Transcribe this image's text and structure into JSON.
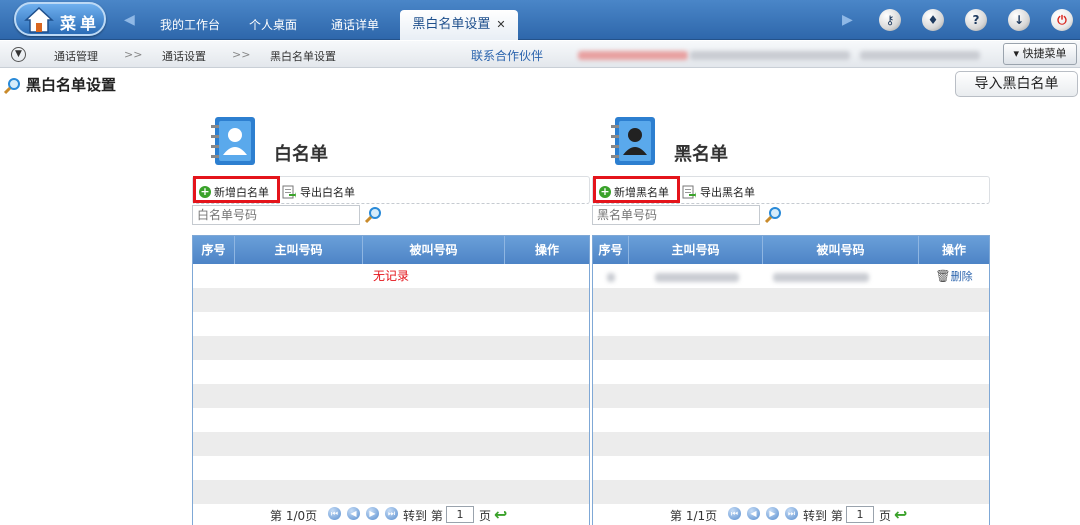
{
  "topbar": {
    "menu_label": "菜单",
    "tabs": [
      {
        "label": "我的工作台"
      },
      {
        "label": "个人桌面"
      },
      {
        "label": "通话详单"
      },
      {
        "label": "黑白名单设置",
        "active": true
      }
    ],
    "close_glyph": "✕",
    "tool_icons": [
      "key-icon",
      "shirt-icon",
      "help-icon",
      "download-icon",
      "power-icon"
    ]
  },
  "breadcrumb": {
    "items": [
      "通话管理",
      "通话设置",
      "黑白名单设置"
    ],
    "separator": ">>",
    "partner_link": "联系合作伙伴",
    "quick_menu": "快捷菜单"
  },
  "page": {
    "title": "黑白名单设置",
    "import_button": "导入黑白名单"
  },
  "whitelist": {
    "title": "白名单",
    "add_label": "新增白名单",
    "export_label": "导出白名单",
    "search_placeholder": "白名单号码",
    "columns": [
      "序号",
      "主叫号码",
      "被叫号码",
      "操作"
    ],
    "empty_text": "无记录",
    "pager": {
      "page_info": "第 1/0页",
      "goto_label": "转到 第",
      "page_value": "1",
      "page_unit": "页"
    }
  },
  "blacklist": {
    "title": "黑名单",
    "add_label": "新增黑名单",
    "export_label": "导出黑名单",
    "search_placeholder": "黑名单号码",
    "columns": [
      "序号",
      "主叫号码",
      "被叫号码",
      "操作"
    ],
    "rows": [
      {
        "delete_label": "删除"
      }
    ],
    "pager": {
      "page_info": "第 1/1页",
      "goto_label": "转到 第",
      "page_value": "1",
      "page_unit": "页"
    }
  },
  "colors": {
    "accent": "#2e67ab",
    "highlight": "#e4141b",
    "link": "#2a63ad"
  }
}
